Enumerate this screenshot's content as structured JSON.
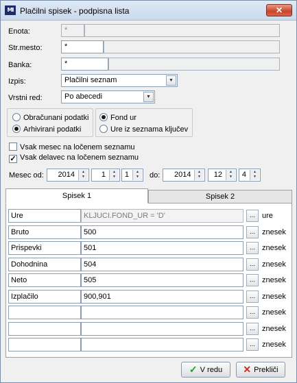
{
  "window": {
    "title": "Plačilni spisek - podpisna lista",
    "app_icon_text": "MI",
    "close_symbol": "✕"
  },
  "form": {
    "enota": {
      "label": "Enota:",
      "code": "*",
      "name": ""
    },
    "strmesto": {
      "label": "Str.mesto:",
      "code": "*",
      "name": ""
    },
    "banka": {
      "label": "Banka:",
      "code": "*",
      "name": ""
    },
    "izpis": {
      "label": "Izpis:",
      "value": "Plačilni seznam"
    },
    "vrstni_red": {
      "label": "Vrstni red:",
      "value": "Po abecedi"
    }
  },
  "data_source": {
    "options": [
      {
        "label": "Obračunani podatki",
        "selected": false
      },
      {
        "label": "Arhivirani podatki",
        "selected": true
      }
    ]
  },
  "hours_source": {
    "options": [
      {
        "label": "Fond ur",
        "selected": true
      },
      {
        "label": "Ure iz seznama ključev",
        "selected": false
      }
    ]
  },
  "checks": [
    {
      "label": "Vsak mesec na ločenem seznamu",
      "checked": false,
      "mark": ""
    },
    {
      "label": "Vsak delavec na ločenem seznamu",
      "checked": true,
      "mark": "✓"
    }
  ],
  "period": {
    "from_label": "Mesec od:",
    "from_year": "2014",
    "from_month": "1",
    "from_day": "1",
    "to_label": "do:",
    "to_year": "2014",
    "to_month": "12",
    "to_day": "4"
  },
  "tabs": [
    {
      "label": "Spisek 1",
      "active": true
    },
    {
      "label": "Spisek 2",
      "active": false
    }
  ],
  "rows": [
    {
      "name": "Ure",
      "expr": "KLJUCI.FOND_UR = 'D'",
      "unit": "ure",
      "readonly": true
    },
    {
      "name": "Bruto",
      "expr": "500",
      "unit": "znesek",
      "readonly": false
    },
    {
      "name": "Prispevki",
      "expr": "501",
      "unit": "znesek",
      "readonly": false
    },
    {
      "name": "Dohodnina",
      "expr": "504",
      "unit": "znesek",
      "readonly": false
    },
    {
      "name": "Neto",
      "expr": "505",
      "unit": "znesek",
      "readonly": false
    },
    {
      "name": "Izplačilo",
      "expr": "900,901",
      "unit": "znesek",
      "readonly": false
    },
    {
      "name": "",
      "expr": "",
      "unit": "znesek",
      "readonly": false
    },
    {
      "name": "",
      "expr": "",
      "unit": "znesek",
      "readonly": false
    },
    {
      "name": "",
      "expr": "",
      "unit": "znesek",
      "readonly": false
    }
  ],
  "dots_label": "...",
  "buttons": {
    "ok": {
      "label": "V redu",
      "icon": "✓"
    },
    "cancel": {
      "label": "Prekliči",
      "icon": "✕"
    }
  },
  "spin_arrows": {
    "up": "▲",
    "down": "▼"
  },
  "select_arrow": "▼"
}
